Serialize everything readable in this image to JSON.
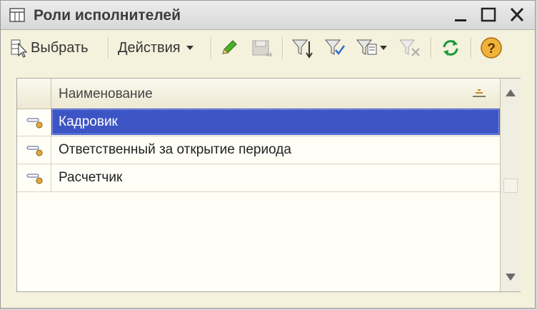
{
  "window": {
    "title": "Роли исполнителей",
    "icons": [
      "table-icon",
      "minimize-icon",
      "maximize-icon",
      "close-icon"
    ]
  },
  "toolbar": {
    "select_label": "Выбрать",
    "actions_label": "Действия",
    "icons": [
      "select-icon",
      "edit-pencil-icon",
      "disabled-save-icon",
      "filter-add-icon",
      "filter-check-icon",
      "filter-list-icon",
      "filter-clear-icon",
      "refresh-icon",
      "help-icon"
    ]
  },
  "table": {
    "column_header": "Наименование",
    "rows": [
      {
        "label": "Кадровик",
        "selected": true
      },
      {
        "label": "Ответственный за открытие периода",
        "selected": false
      },
      {
        "label": "Расчетчик",
        "selected": false
      }
    ]
  },
  "colors": {
    "background": "#f4f1dc",
    "selection": "#3d55c4",
    "refresh": "#1a9a3a",
    "help": "#e8a028"
  }
}
